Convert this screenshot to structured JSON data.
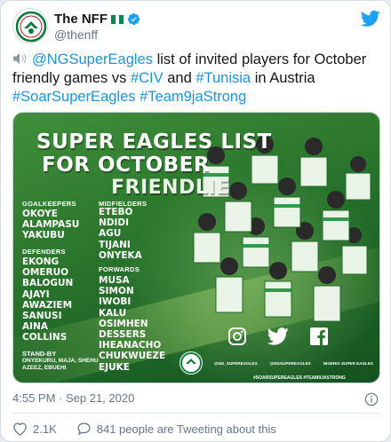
{
  "account": {
    "display_name": "The NFF",
    "handle": "@thenff",
    "flag_colors": [
      "#008751",
      "#ffffff",
      "#008751"
    ],
    "verified_color": "#1da1f2"
  },
  "icons": {
    "twitter": "twitter-bird-icon",
    "speaker": "speaker-icon",
    "info": "info-icon",
    "heart": "heart-icon",
    "reply": "reply-bubble-icon"
  },
  "tweet": {
    "mention": "@NGSuperEagles",
    "text_1": " list of invited players for October friendly games vs ",
    "tag_civ": "#CIV",
    "text_2": " and ",
    "tag_tunisia": "#Tunisia",
    "text_3": " in Austria",
    "tag_soar": "#SoarSuperEagles",
    "tag_team": "#Team9jaStrong"
  },
  "graphic": {
    "headline_1": "SUPER EAGLES LIST",
    "headline_2": "FOR OCTOBER",
    "headline_3": "FRIENDLIE",
    "goalkeepers_label": "GOALKEEPERS",
    "goalkeepers": [
      "OKOYE",
      "ALAMPASU",
      "YAKUBU"
    ],
    "defenders_label": "DEFENDERS",
    "defenders": [
      "EKONG",
      "OMERUO",
      "BALOGUN",
      "AJAYI",
      "AWAZIEM",
      "SANUSI",
      "AINA",
      "COLLINS"
    ],
    "midfielders_label": "MIDFIELDERS",
    "midfielders": [
      "ETEBO",
      "NDIDI",
      "AGU",
      "TIJANI",
      "ONYEKA"
    ],
    "forwards_label": "FORWARDS",
    "forwards": [
      "MUSA",
      "SIMON",
      "IWOBI",
      "KALU",
      "OSIMHEN",
      "DESSERS",
      "IHEANACHO",
      "CHUKWUEZE",
      "EJUKE"
    ],
    "standby_label": "STAND-BY",
    "standby_line_1": "ONYEKURU, MAJA, SHEHU",
    "standby_line_2": "AZEEZ, EBUEHI",
    "handle_instagram": "@NG_SUPEREAGLES",
    "handle_twitter": "@NGSUPEREAGLES",
    "handle_facebook": "NIGERIA SUPER EAGLES",
    "hashtags": "#SOARSUPEREAGLES #TEAM9JASTRONG"
  },
  "meta": {
    "timestamp": "4:55 PM · Sep 21, 2020",
    "likes": "2.1K",
    "retweet_text": "841 people are Tweeting about this"
  },
  "colors": {
    "link": "#1b95e0",
    "muted": "#657786",
    "like_red": "#e0245e"
  }
}
